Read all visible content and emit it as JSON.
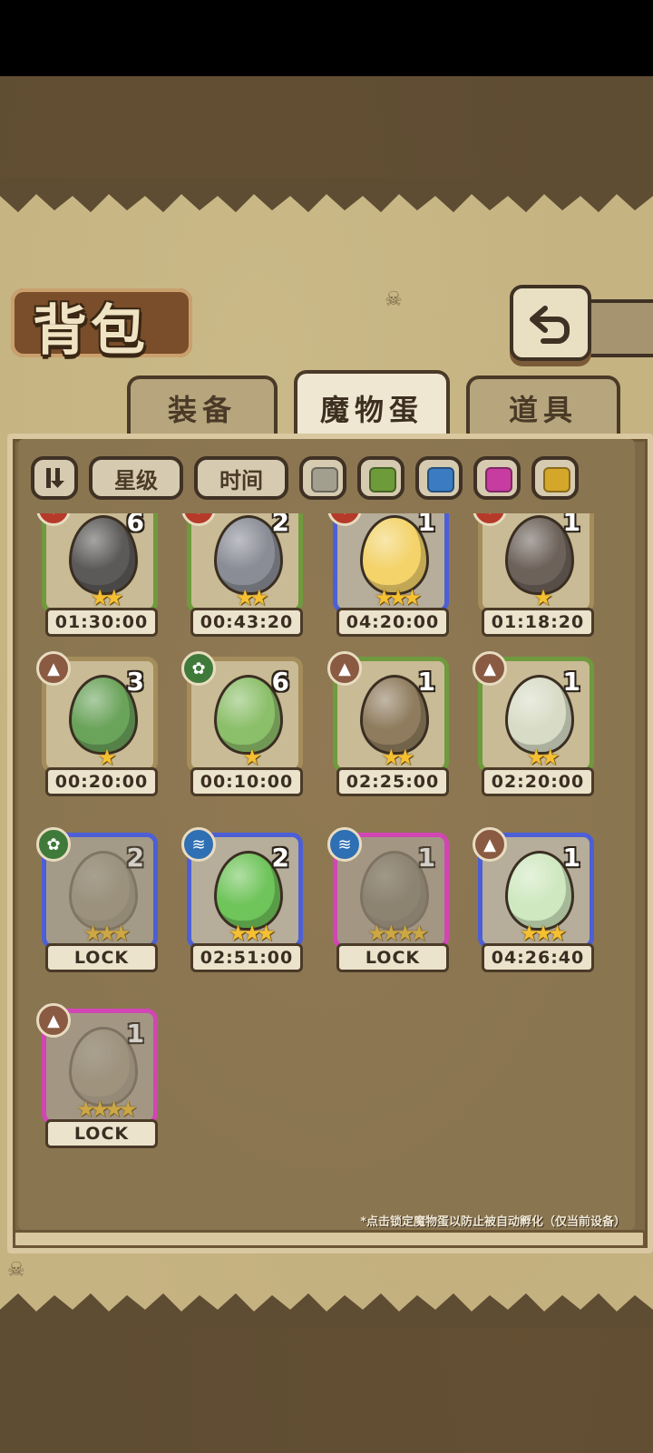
{
  "header": {
    "title": "背包"
  },
  "tabs": [
    {
      "label": "装备",
      "active": false
    },
    {
      "label": "魔物蛋",
      "active": true
    },
    {
      "label": "道具",
      "active": false
    }
  ],
  "filters": {
    "sort_icon": "sort-toggle-icon",
    "star_label": "星级",
    "time_label": "时间",
    "colors": [
      "#a39f8f",
      "#6e9b3a",
      "#3b7bc2",
      "#c63ca0",
      "#d4a72a"
    ]
  },
  "eggs": [
    {
      "element": "fire",
      "count": "6",
      "stars": 2,
      "rarity": "green",
      "timer": "01:30:00",
      "locked": false,
      "color": "#5c5a58"
    },
    {
      "element": "fire",
      "count": "2",
      "stars": 2,
      "rarity": "green",
      "timer": "00:43:20",
      "locked": false,
      "color": "#8a8c96"
    },
    {
      "element": "fire",
      "count": "1",
      "stars": 3,
      "rarity": "blue",
      "timer": "04:20:00",
      "locked": false,
      "color": "#f3d36a"
    },
    {
      "element": "fire",
      "count": "1",
      "stars": 1,
      "rarity": "brown",
      "timer": "01:18:20",
      "locked": false,
      "color": "#6d625a"
    },
    {
      "element": "earth",
      "count": "3",
      "stars": 1,
      "rarity": "brown",
      "timer": "00:20:00",
      "locked": false,
      "color": "#6aa35a"
    },
    {
      "element": "grass",
      "count": "6",
      "stars": 1,
      "rarity": "brown",
      "timer": "00:10:00",
      "locked": false,
      "color": "#8cbf6a"
    },
    {
      "element": "earth",
      "count": "1",
      "stars": 2,
      "rarity": "green",
      "timer": "02:25:00",
      "locked": false,
      "color": "#8f7c5e"
    },
    {
      "element": "earth",
      "count": "1",
      "stars": 2,
      "rarity": "green",
      "timer": "02:20:00",
      "locked": false,
      "color": "#d8dcc6"
    },
    {
      "element": "grass",
      "count": "2",
      "stars": 3,
      "rarity": "blue",
      "timer": "LOCK",
      "locked": true,
      "color": "#9a8f7a"
    },
    {
      "element": "water",
      "count": "2",
      "stars": 3,
      "rarity": "blue",
      "timer": "02:51:00",
      "locked": false,
      "color": "#6fc45a"
    },
    {
      "element": "water",
      "count": "1",
      "stars": 4,
      "rarity": "pink",
      "timer": "LOCK",
      "locked": true,
      "color": "#6b6656"
    },
    {
      "element": "earth",
      "count": "1",
      "stars": 3,
      "rarity": "blue",
      "timer": "04:26:40",
      "locked": false,
      "color": "#cfe8c0"
    },
    {
      "element": "earth",
      "count": "1",
      "stars": 4,
      "rarity": "pink",
      "timer": "LOCK",
      "locked": true,
      "color": "#a89c84"
    }
  ],
  "footnote": "*点击锁定魔物蛋以防止被自动孵化（仅当前设备）"
}
